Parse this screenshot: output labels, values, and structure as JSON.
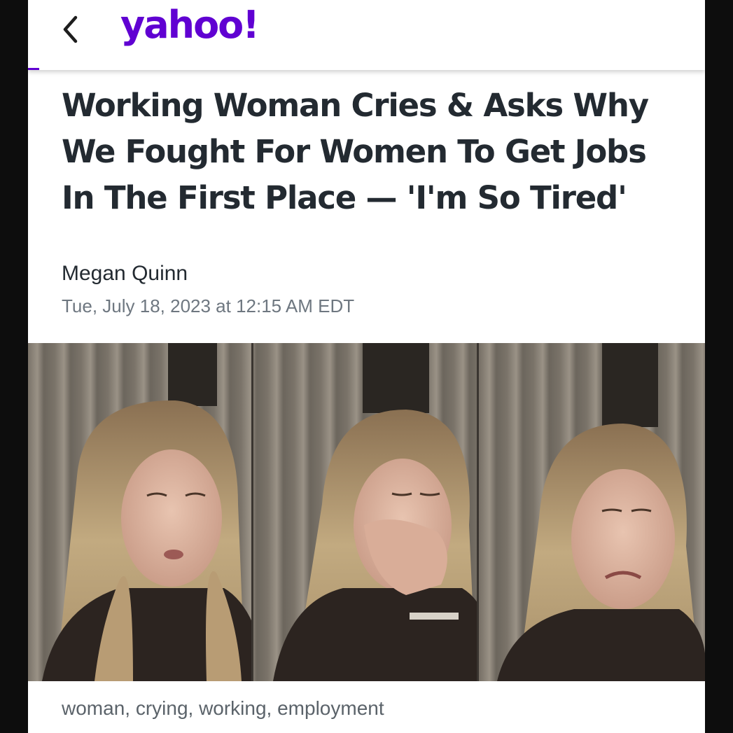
{
  "header": {
    "logo_text": "yahoo!",
    "back_icon": "chevron-left-icon",
    "brand_color": "#6001d2"
  },
  "article": {
    "headline_lines": [
      "Working Woman Cries & Asks Why",
      "We Fought For Women To Get Jobs",
      "In The First Place — 'I'm So Tired'"
    ],
    "author": "Megan Quinn",
    "published": "Tue, July 18, 2023 at 12:15 AM EDT",
    "image_panels": 3,
    "caption": "woman, crying, working, employment"
  }
}
